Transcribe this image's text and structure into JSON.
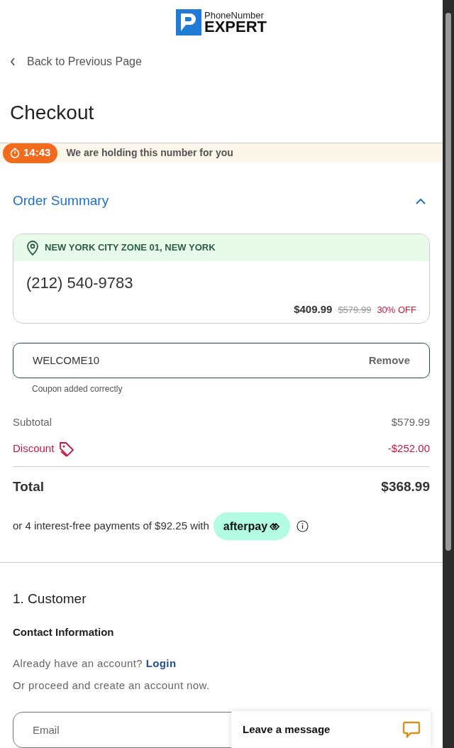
{
  "logo": {
    "line1": "PhoneNumber",
    "line2": "EXPERT"
  },
  "back_link": "Back to Previous Page",
  "title": "Checkout",
  "hold_banner": {
    "timer": "14:43",
    "message": "We are holding this number for you"
  },
  "order_summary": {
    "title": "Order Summary",
    "expanded": true,
    "number_card": {
      "location": "NEW YORK CITY ZONE 01, NEW YORK",
      "number": "(212) 540-9783",
      "price": "$409.99",
      "old_price": "$579.99",
      "discount": "30% OFF"
    },
    "coupon": {
      "value": "WELCOME10",
      "action": "Remove",
      "helper": "Coupon added correctly"
    },
    "lines": [
      {
        "kind": "plain",
        "label": "Subtotal",
        "amount": "$579.99"
      },
      {
        "kind": "discount",
        "label": "Discount",
        "amount": "-$252.00"
      }
    ],
    "total": {
      "label": "Total",
      "amount": "$368.99"
    },
    "afterpay": {
      "text": "or 4 interest-free payments of $92.25 with",
      "badge": "afterpay"
    }
  },
  "customer": {
    "title": "1. Customer",
    "subtitle": "Contact Information",
    "account_prompt": "Already have an account?",
    "login": "Login",
    "proceed": "Or proceed and create an account now.",
    "email_placeholder": "Email"
  },
  "chat_widget": {
    "label": "Leave a message"
  }
}
